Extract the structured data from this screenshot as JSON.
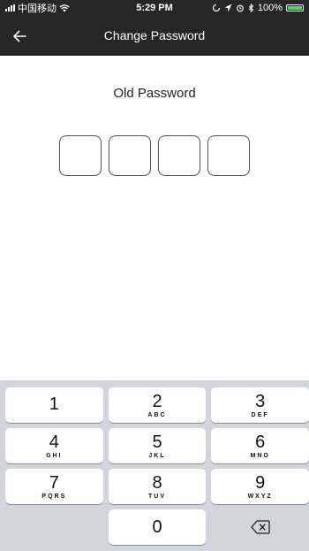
{
  "status_bar": {
    "carrier": "中国移动",
    "time": "5:29 PM",
    "battery": "100%",
    "battery_level": 1.0,
    "icons": [
      "signal-icon",
      "wifi-icon",
      "orientation-lock-icon",
      "location-icon",
      "alarm-icon",
      "bluetooth-icon",
      "battery-icon"
    ]
  },
  "nav": {
    "title": "Change Password",
    "back_icon": "back-arrow-icon"
  },
  "main": {
    "prompt": "Old Password",
    "code_length": 4
  },
  "keypad": {
    "rows": [
      [
        {
          "digit": "1",
          "letters": ""
        },
        {
          "digit": "2",
          "letters": "ABC"
        },
        {
          "digit": "3",
          "letters": "DEF"
        }
      ],
      [
        {
          "digit": "4",
          "letters": "GHI"
        },
        {
          "digit": "5",
          "letters": "JKL"
        },
        {
          "digit": "6",
          "letters": "MNO"
        }
      ],
      [
        {
          "digit": "7",
          "letters": "PQRS"
        },
        {
          "digit": "8",
          "letters": "TUV"
        },
        {
          "digit": "9",
          "letters": "WXYZ"
        }
      ]
    ],
    "zero": "0",
    "delete_icon": "backspace-icon"
  },
  "colors": {
    "bar_bg": "#262626",
    "keypad_bg": "#d2d5db",
    "battery_fill": "#4cd964"
  }
}
